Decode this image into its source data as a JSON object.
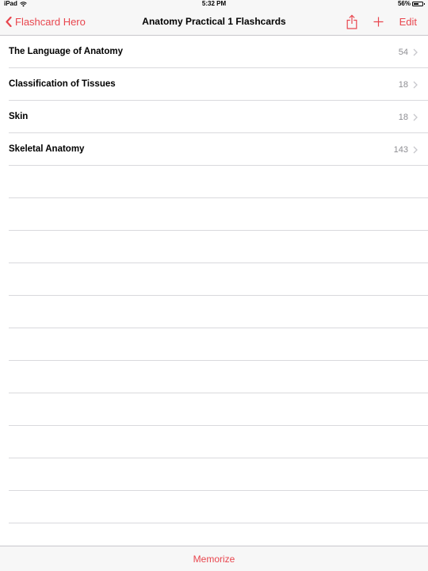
{
  "status_bar": {
    "device": "iPad",
    "time": "5:32 PM",
    "battery_percent": "56%",
    "battery_level": 0.56,
    "wifi_icon": "wifi-icon",
    "battery_icon": "battery-icon"
  },
  "nav": {
    "back_label": "Flashcard Hero",
    "back_icon": "chevron-left-icon",
    "title": "Anatomy Practical 1 Flashcards",
    "share_icon": "share-icon",
    "add_icon": "plus-icon",
    "edit_label": "Edit"
  },
  "decks": [
    {
      "title": "The Language of Anatomy",
      "count": "54"
    },
    {
      "title": "Classification of Tissues",
      "count": "18"
    },
    {
      "title": "Skin",
      "count": "18"
    },
    {
      "title": "Skeletal Anatomy",
      "count": "143"
    }
  ],
  "empty_rows": 12,
  "toolbar": {
    "memorize_label": "Memorize"
  },
  "colors": {
    "accent": "#e8464e",
    "bar_background": "#f7f7f7",
    "separator": "#d9d9dd",
    "secondary_text": "#8e8e93"
  }
}
